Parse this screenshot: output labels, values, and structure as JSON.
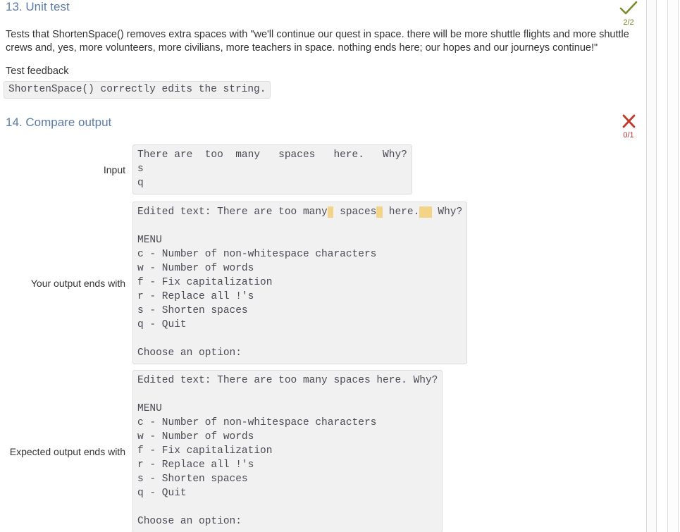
{
  "section13": {
    "heading": "13. Unit test",
    "description": "Tests that ShortenSpace() removes extra spaces with \"we'll continue our quest in space. there will be more shuttle flights and more shuttle crews and, yes, more volunteers, more civilians, more teachers in space. nothing ends here; our hopes and our journeys continue!\"",
    "feedback_label": "Test feedback",
    "feedback_text": "ShortenSpace() correctly edits the string.",
    "status": {
      "icon": "checkmark-icon",
      "score": "2/2",
      "color": "#7d8a2e",
      "state": "pass"
    }
  },
  "section14": {
    "heading": "14. Compare output",
    "status": {
      "icon": "cross-icon",
      "score": "0/1",
      "color": "#c0392b",
      "state": "fail"
    },
    "input": {
      "label": "Input",
      "lines": [
        "There are  too  many   spaces   here.   Why?",
        "s",
        "q"
      ],
      "text": "There are  too  many   spaces   here.   Why?\ns\nq"
    },
    "your_output": {
      "label": "Your output ends with",
      "first_line_segments": [
        {
          "text": "Edited text: There are too many",
          "highlight": false
        },
        {
          "text": " ",
          "highlight": true
        },
        {
          "text": " spaces",
          "highlight": false
        },
        {
          "text": " ",
          "highlight": true
        },
        {
          "text": " here.",
          "highlight": false
        },
        {
          "text": "  ",
          "highlight": true
        },
        {
          "text": " Why?",
          "highlight": false
        }
      ],
      "remaining_lines": [
        "",
        "MENU",
        "c - Number of non-whitespace characters",
        "w - Number of words",
        "f - Fix capitalization",
        "r - Replace all !'s",
        "s - Shorten spaces",
        "q - Quit",
        "",
        "Choose an option:"
      ],
      "highlight_color": "#f2d388"
    },
    "expected_output": {
      "label": "Expected output ends with",
      "lines": [
        "Edited text: There are too many spaces here. Why?",
        "",
        "MENU",
        "c - Number of non-whitespace characters",
        "w - Number of words",
        "f - Fix capitalization",
        "r - Replace all !'s",
        "s - Shorten spaces",
        "q - Quit",
        "",
        "Choose an option:"
      ],
      "text": "Edited text: There are too many spaces here. Why?\n\nMENU\nc - Number of non-whitespace characters\nw - Number of words\nf - Fix capitalization\nr - Replace all !'s\ns - Shorten spaces\nq - Quit\n\nChoose an option:"
    }
  },
  "theme": {
    "heading_color": "#5b7ba5",
    "code_bg": "#f1f1f1",
    "code_border": "#dcdcdc",
    "body_text": "#333333"
  }
}
